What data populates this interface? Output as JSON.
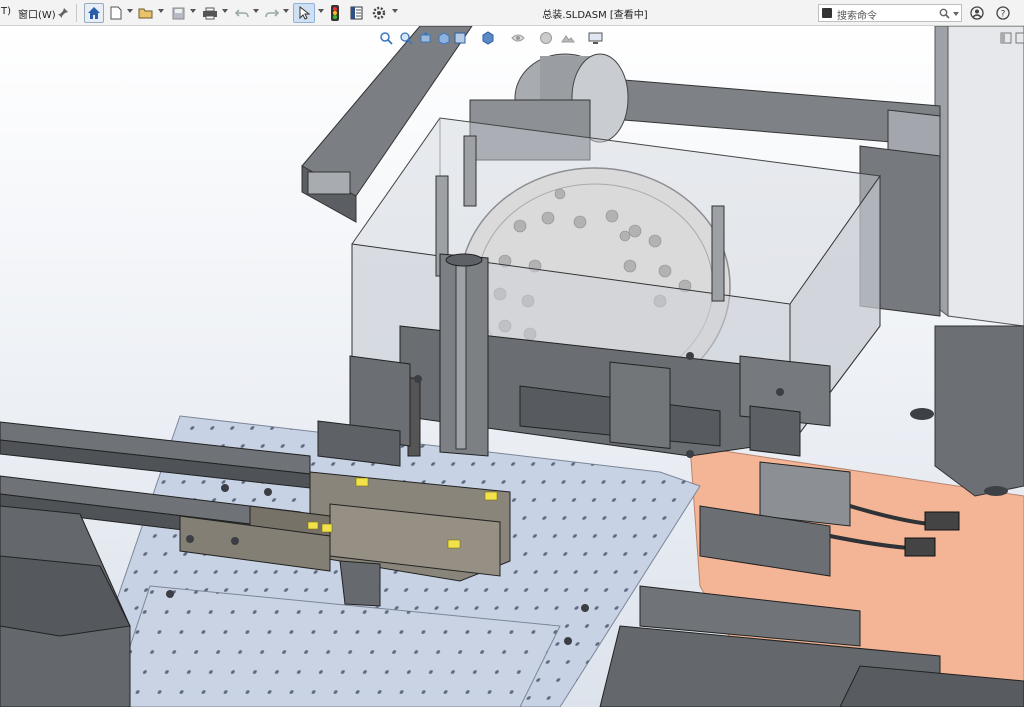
{
  "menu": {
    "partial_left": "T)",
    "window": "窗口(W)"
  },
  "document": {
    "title": "总装.SLDASM [查看中]"
  },
  "search": {
    "placeholder": "搜索命令"
  },
  "toolbar_icons": [
    "pin-icon",
    "home-icon",
    "new-document-icon",
    "open-folder-icon",
    "save-icon",
    "print-icon",
    "undo-icon",
    "redo-icon",
    "select-cursor-icon",
    "traffic-light-icon",
    "file-properties-icon",
    "options-gear-icon"
  ],
  "heads_up_icons": [
    "zoom-to-fit-icon",
    "zoom-area-icon",
    "previous-view-icon",
    "section-view-icon",
    "view-orientation-icon",
    "display-style-icon",
    "hide-show-icon",
    "edit-appearance-icon",
    "scene-icon",
    "view-settings-icon"
  ],
  "colors": {
    "background_top": "#ffffff",
    "background_bottom": "#dde3ec",
    "metal": "#6f7277",
    "base_plate": "#c7d2e4",
    "copper_plate": "#f3b596",
    "accent_yellow": "#f2e24a"
  }
}
